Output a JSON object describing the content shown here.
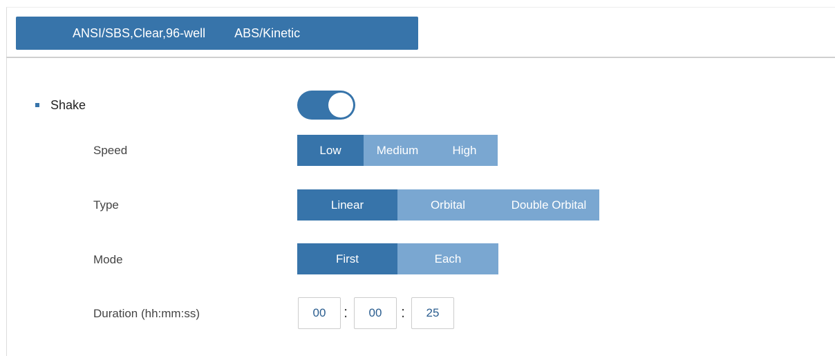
{
  "method": {
    "plate": "ANSI/SBS,Clear,96-well",
    "mode": "ABS/Kinetic"
  },
  "shake": {
    "label": "Shake",
    "enabled": true
  },
  "speed": {
    "label": "Speed",
    "options": [
      "Low",
      "Medium",
      "High"
    ],
    "selected": "Low"
  },
  "type": {
    "label": "Type",
    "options": [
      "Linear",
      "Orbital",
      "Double Orbital"
    ],
    "selected": "Linear"
  },
  "mode": {
    "label": "Mode",
    "options": [
      "First",
      "Each"
    ],
    "selected": "First"
  },
  "duration": {
    "label": "Duration (hh:mm:ss)",
    "hours": "00",
    "minutes": "00",
    "seconds": "25",
    "separator": ":"
  },
  "colors": {
    "accent": "#3774aa",
    "inactive_segment": "#7aa7d1"
  }
}
